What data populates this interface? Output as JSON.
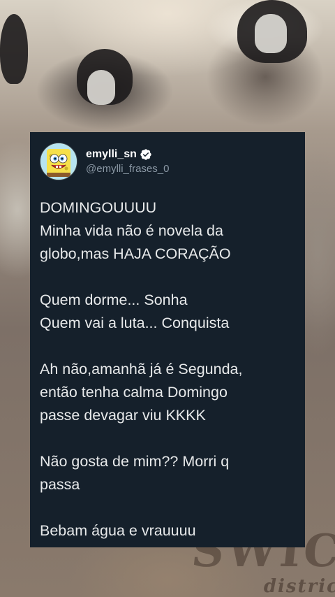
{
  "post": {
    "display_name": "emylli_sn",
    "handle": "@emylli_frases_0",
    "avatar_icon": "spongebob-avatar-icon",
    "verified_icon": "verified-badge-icon",
    "paragraphs": [
      [
        "DOMINGOUUUU",
        "Minha vida não é novela da",
        "globo,mas HAJA CORAÇÃO"
      ],
      [
        "Quem dorme... Sonha",
        "Quem vai a luta... Conquista"
      ],
      [
        "Ah não,amanhã já é Segunda,",
        "então tenha calma Domingo",
        "passe devagar viu KKKK"
      ],
      [
        "Não gosta de mim?? Morri q",
        "passa"
      ],
      [
        "Bebam água e vrauuuu"
      ]
    ]
  },
  "colors": {
    "card_bg": "#15202b",
    "text": "#e7e9ea",
    "handle": "#8b98a5",
    "verified": "#ffffff"
  }
}
